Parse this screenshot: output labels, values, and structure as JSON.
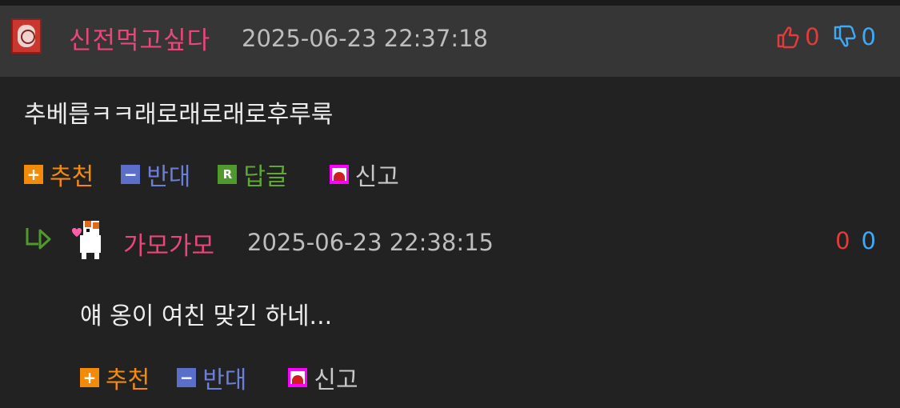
{
  "comment": {
    "username": "신전먹고싶다",
    "datetime": "2025-06-23 22:37:18",
    "upvotes": "0",
    "downvotes": "0",
    "text": "추베릅ㅋㅋ래로래로래로후루룩",
    "actions": {
      "recommend": "추천",
      "oppose": "반대",
      "reply": "답글",
      "report": "신고",
      "reply_badge": "R"
    }
  },
  "reply": {
    "username": "가모가모",
    "datetime": "2025-06-23 22:38:15",
    "upvotes": "0",
    "downvotes": "0",
    "text": "얘 옹이 여친 맞긴 하네...",
    "actions": {
      "recommend": "추천",
      "oppose": "반대",
      "report": "신고"
    }
  },
  "colors": {
    "username": "#e9467a",
    "upvote": "#e33b3b",
    "downvote": "#3fa9f5",
    "recommend": "#f28a0a",
    "oppose": "#6b7ed8",
    "reply": "#5fa835"
  },
  "icons": [
    "thumbs-up-icon",
    "thumbs-down-icon",
    "plus-icon",
    "minus-icon",
    "reply-icon",
    "siren-icon",
    "reply-arrow-icon"
  ]
}
